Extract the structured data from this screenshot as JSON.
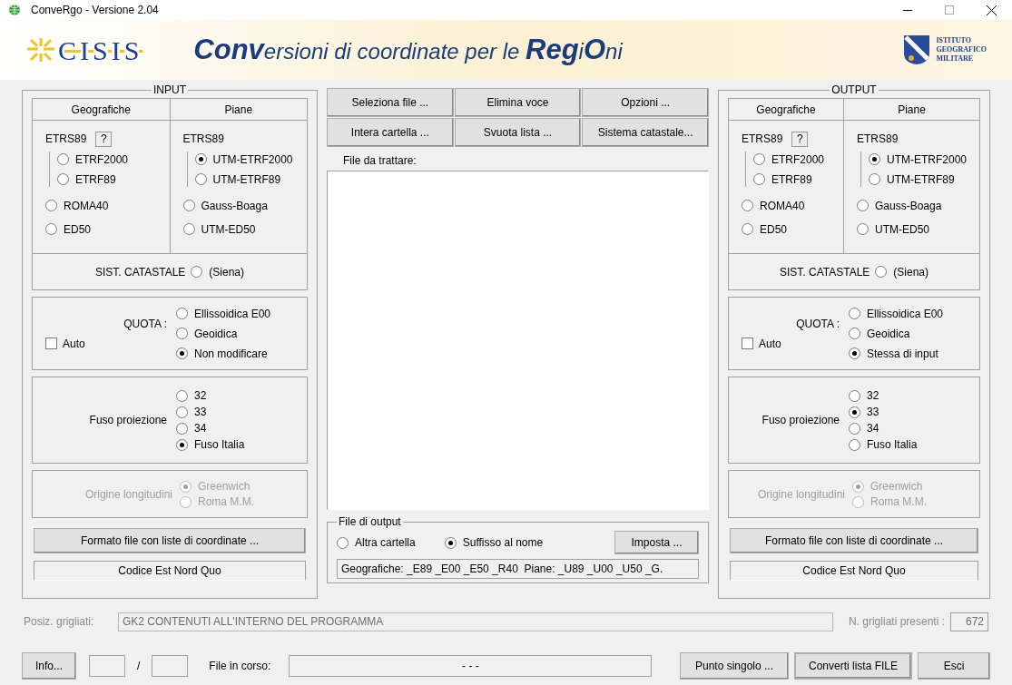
{
  "window": {
    "title": "ConveRgo - Versione 2.04"
  },
  "banner": {
    "logo_text": "CISIS",
    "title": "**Conv**ersioni di coordinate per le **Reg**i**O**ni",
    "institute_lines": [
      "ISTITUTO",
      "GEOGRAFICO",
      "MILITARE"
    ]
  },
  "panels": [
    {
      "title": "INPUT",
      "columns": [
        {
          "header": "Geografiche",
          "group": "ETRS89",
          "help": "?",
          "sub_options": [
            {
              "label": "ETRF2000",
              "selected": false
            },
            {
              "label": "ETRF89",
              "selected": false
            }
          ],
          "options": [
            {
              "label": "ROMA40",
              "selected": false
            },
            {
              "label": "ED50",
              "selected": false
            }
          ]
        },
        {
          "header": "Piane",
          "group": "ETRS89",
          "sub_options": [
            {
              "label": "UTM-ETRF2000",
              "selected": true
            },
            {
              "label": "UTM-ETRF89",
              "selected": false
            }
          ],
          "options": [
            {
              "label": "Gauss-Boaga",
              "selected": false
            },
            {
              "label": "UTM-ED50",
              "selected": false
            }
          ]
        }
      ],
      "catastale": {
        "label": "SIST. CATASTALE",
        "option": {
          "label": "(Siena)",
          "selected": false
        }
      },
      "quota": {
        "label": "QUOTA :",
        "auto": {
          "label": "Auto",
          "checked": false
        },
        "options": [
          {
            "label": "Ellissoidica E00",
            "selected": false
          },
          {
            "label": "Geoidica",
            "selected": false
          },
          {
            "label": "Non modificare",
            "selected": true
          }
        ]
      },
      "fuso": {
        "label": "Fuso proiezione",
        "options": [
          {
            "label": "32",
            "selected": false
          },
          {
            "label": "33",
            "selected": false
          },
          {
            "label": "34",
            "selected": false
          },
          {
            "label": "Fuso Italia",
            "selected": true
          }
        ]
      },
      "origine": {
        "label": "Origine longitudini",
        "disabled": true,
        "options": [
          {
            "label": "Greenwich",
            "selected": true
          },
          {
            "label": "Roma M.M.",
            "selected": false
          }
        ]
      },
      "format_button": "Formato file con liste di coordinate ...",
      "format_value": "Codice Est Nord Quo"
    },
    {
      "title": "OUTPUT",
      "columns": [
        {
          "header": "Geografiche",
          "group": "ETRS89",
          "help": "?",
          "sub_options": [
            {
              "label": "ETRF2000",
              "selected": false
            },
            {
              "label": "ETRF89",
              "selected": false
            }
          ],
          "options": [
            {
              "label": "ROMA40",
              "selected": false
            },
            {
              "label": "ED50",
              "selected": false
            }
          ]
        },
        {
          "header": "Piane",
          "group": "ETRS89",
          "sub_options": [
            {
              "label": "UTM-ETRF2000",
              "selected": true
            },
            {
              "label": "UTM-ETRF89",
              "selected": false
            }
          ],
          "options": [
            {
              "label": "Gauss-Boaga",
              "selected": false
            },
            {
              "label": "UTM-ED50",
              "selected": false
            }
          ]
        }
      ],
      "catastale": {
        "label": "SIST. CATASTALE",
        "option": {
          "label": "(Siena)",
          "selected": false
        }
      },
      "quota": {
        "label": "QUOTA :",
        "auto": {
          "label": "Auto",
          "checked": false
        },
        "options": [
          {
            "label": "Ellissoidica E00",
            "selected": false
          },
          {
            "label": "Geoidica",
            "selected": false
          },
          {
            "label": "Stessa di input",
            "selected": true
          }
        ]
      },
      "fuso": {
        "label": "Fuso proiezione",
        "options": [
          {
            "label": "32",
            "selected": false
          },
          {
            "label": "33",
            "selected": true
          },
          {
            "label": "34",
            "selected": false
          },
          {
            "label": "Fuso Italia",
            "selected": false
          }
        ]
      },
      "origine": {
        "label": "Origine longitudini",
        "disabled": true,
        "options": [
          {
            "label": "Greenwich",
            "selected": true
          },
          {
            "label": "Roma M.M.",
            "selected": false
          }
        ]
      },
      "format_button": "Formato file con liste di coordinate ...",
      "format_value": "Codice Est Nord Quo"
    }
  ],
  "actions": [
    "Seleziona file ...",
    "Elimina voce",
    "Opzioni ...",
    "Intera cartella ...",
    "Svuota lista ...",
    "Sistema catastale..."
  ],
  "file_list": {
    "label": "File da trattare:"
  },
  "file_output": {
    "title": "File di output",
    "options": [
      {
        "label": "Altra cartella",
        "selected": false
      },
      {
        "label": "Suffisso al nome",
        "selected": true
      }
    ],
    "button": "Imposta ...",
    "value": "Geografiche: _E89 _E00 _E50 _R40  Piane: _U89 _U00 _U50 _G."
  },
  "grids": {
    "position_label": "Posiz. grigliati:",
    "position_value": "GK2 CONTENUTI ALL'INTERNO DEL PROGRAMMA",
    "count_label": "N. grigliati presenti :",
    "count_value": "672"
  },
  "footer": {
    "info_button": "Info...",
    "separator": "/",
    "file_label": "File in corso:",
    "file_value": "- - -",
    "buttons": [
      {
        "label": "Punto singolo ...",
        "default": false
      },
      {
        "label": "Converti lista FILE",
        "default": true
      },
      {
        "label": "Esci",
        "default": false
      }
    ]
  }
}
